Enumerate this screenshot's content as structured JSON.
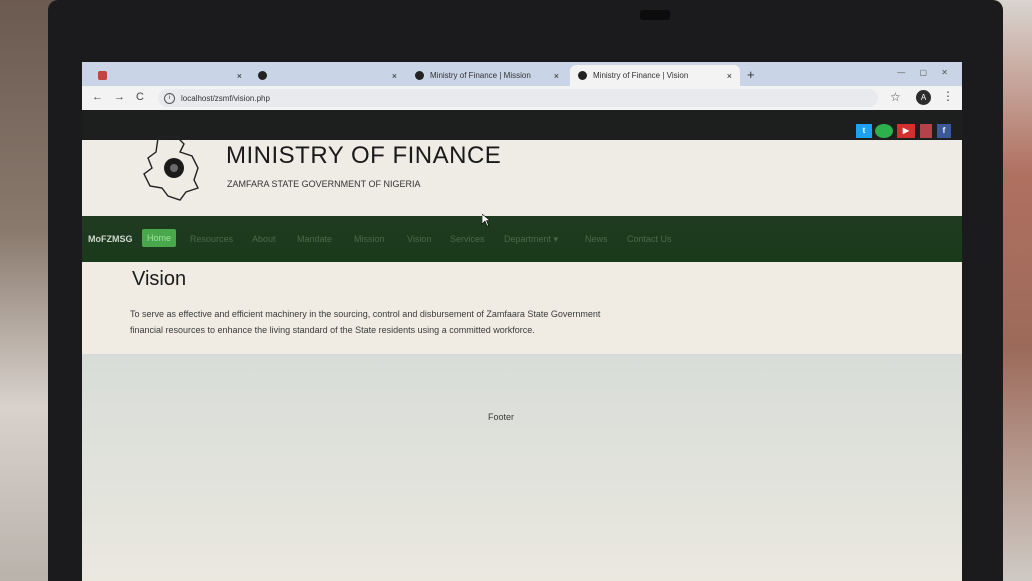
{
  "browser": {
    "tabs": [
      {
        "title": "",
        "close": "×"
      },
      {
        "title": "",
        "close": "×"
      },
      {
        "title": "Ministry of Finance | Mission",
        "close": "×"
      },
      {
        "title": "Ministry of Finance | Vision",
        "close": "×"
      }
    ],
    "new_tab": "+",
    "url": "localhost/zsmf/vision.php",
    "avatar_letter": "A"
  },
  "social": [
    "twitter",
    "whatsapp",
    "youtube",
    "instagram",
    "facebook"
  ],
  "header": {
    "title": "MINISTRY OF FINANCE",
    "subtitle": "ZAMFARA STATE GOVERNMENT OF NIGERIA"
  },
  "navbar": {
    "brand": "MoFZMSG",
    "items": [
      "Home",
      "Resources",
      "About",
      "Mandate",
      "Mission",
      "Vision",
      "Services",
      "Department ▾",
      "News",
      "Contact Us"
    ]
  },
  "content": {
    "heading": "Vision",
    "paragraph": "To serve as effective and efficient machinery in the sourcing, control and disbursement of Zamfaara State Government financial resources to enhance the living standard of the State residents using a committed workforce."
  },
  "footer": {
    "text": "Footer"
  },
  "colors": {
    "navbar": "#1a3a1c",
    "active": "#49a84b",
    "topbar": "#1d1f1e"
  }
}
